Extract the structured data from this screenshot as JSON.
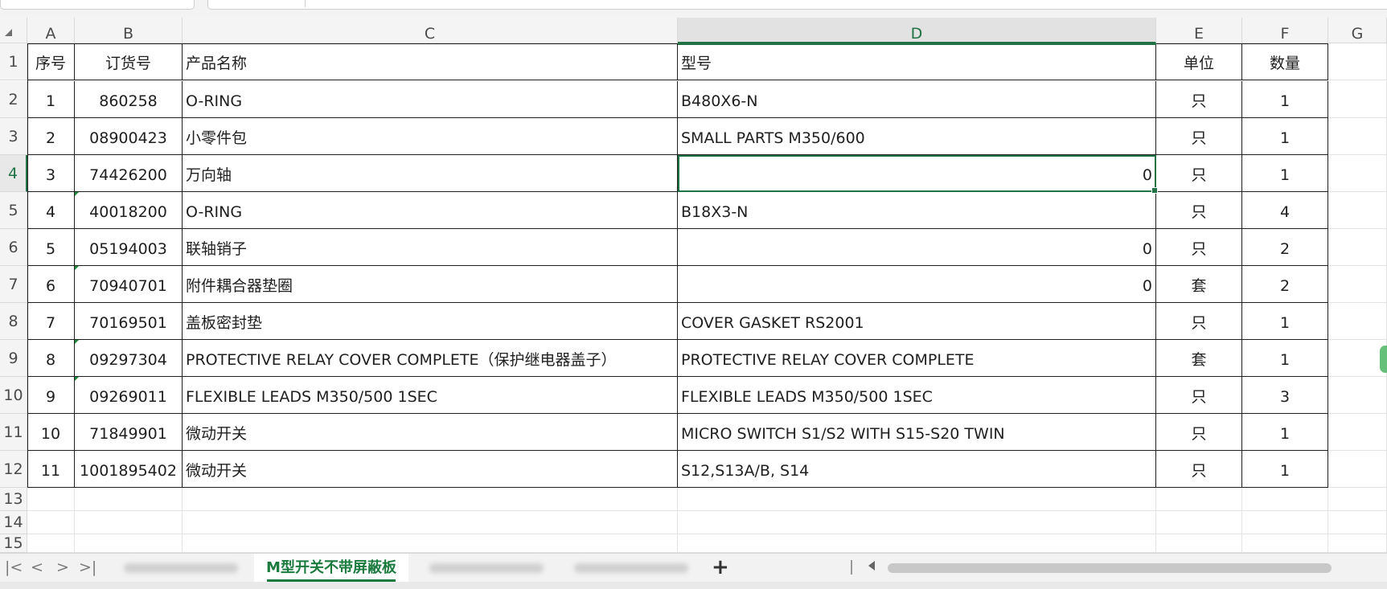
{
  "columns": [
    "A",
    "B",
    "C",
    "D",
    "E",
    "F",
    "G"
  ],
  "row_numbers": [
    "1",
    "2",
    "3",
    "4",
    "5",
    "6",
    "7",
    "8",
    "9",
    "10",
    "11",
    "12",
    "13",
    "14",
    "15"
  ],
  "header_row": [
    "序号",
    "订货号",
    "产品名称",
    "型号",
    "单位",
    "数量"
  ],
  "rows": [
    [
      "1",
      "860258",
      "O-RING",
      "B480X6-N",
      "只",
      "1"
    ],
    [
      "2",
      "08900423",
      "小零件包",
      "SMALL PARTS M350/600",
      "只",
      "1"
    ],
    [
      "3",
      "74426200",
      "万向轴",
      "0",
      "只",
      "1"
    ],
    [
      "4",
      "40018200",
      "O-RING",
      "B18X3-N",
      "只",
      "4"
    ],
    [
      "5",
      "05194003",
      "联轴销子",
      "0",
      "只",
      "2"
    ],
    [
      "6",
      "70940701",
      "附件耦合器垫圈",
      "0",
      "套",
      "2"
    ],
    [
      "7",
      "70169501",
      "盖板密封垫",
      "COVER GASKET RS2001",
      "只",
      "1"
    ],
    [
      "8",
      "09297304",
      "PROTECTIVE RELAY COVER COMPLETE（保护继电器盖子）",
      "PROTECTIVE RELAY COVER COMPLETE",
      "套",
      "1"
    ],
    [
      "9",
      "09269011",
      "FLEXIBLE LEADS M350/500 1SEC",
      "FLEXIBLE LEADS M350/500 1SEC",
      "只",
      "3"
    ],
    [
      "10",
      "71849901",
      "微动开关",
      "MICRO SWITCH S1/S2 WITH S15-S20 TWIN",
      "只",
      "1"
    ],
    [
      "11",
      "1001895402",
      "微动开关",
      "S12,S13A/B, S14",
      "只",
      "1"
    ]
  ],
  "selection": {
    "column": "D",
    "row": "4"
  },
  "sheet_tabs": {
    "active": "M型开关不带屏蔽板",
    "add_label": "+"
  },
  "nav": {
    "first": "|<",
    "prev": "<",
    "next": ">",
    "last": ">|"
  },
  "colors": {
    "accent": "#217346",
    "tab_active": "#1b7a3e"
  }
}
